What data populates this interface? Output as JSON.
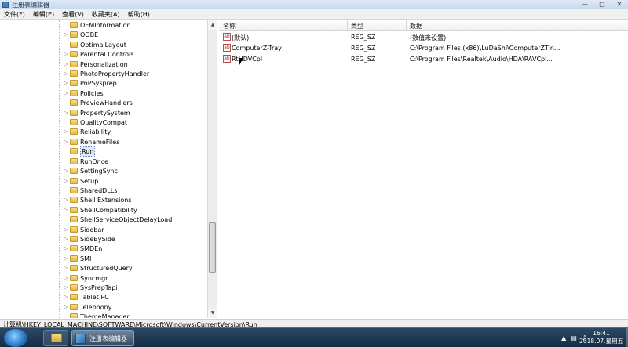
{
  "window": {
    "title": "注册表编辑器"
  },
  "menu": [
    "文件(F)",
    "编辑(E)",
    "查看(V)",
    "收藏夹(A)",
    "帮助(H)"
  ],
  "tree": {
    "items": [
      {
        "label": "OEMInformation",
        "expandable": false
      },
      {
        "label": "OOBE",
        "expandable": true
      },
      {
        "label": "OptimalLayout",
        "expandable": false
      },
      {
        "label": "Parental Controls",
        "expandable": true
      },
      {
        "label": "Personalization",
        "expandable": true
      },
      {
        "label": "PhotoPropertyHandler",
        "expandable": true
      },
      {
        "label": "PnPSysprep",
        "expandable": true
      },
      {
        "label": "Policies",
        "expandable": true
      },
      {
        "label": "PreviewHandlers",
        "expandable": false
      },
      {
        "label": "PropertySystem",
        "expandable": true
      },
      {
        "label": "QualityCompat",
        "expandable": false
      },
      {
        "label": "Reliability",
        "expandable": true
      },
      {
        "label": "RenameFiles",
        "expandable": true
      },
      {
        "label": "Run",
        "expandable": false,
        "selected": true
      },
      {
        "label": "RunOnce",
        "expandable": false
      },
      {
        "label": "SettingSync",
        "expandable": true
      },
      {
        "label": "Setup",
        "expandable": true
      },
      {
        "label": "SharedDLLs",
        "expandable": false
      },
      {
        "label": "Shell Extensions",
        "expandable": true
      },
      {
        "label": "ShellCompatibility",
        "expandable": true
      },
      {
        "label": "ShellServiceObjectDelayLoad",
        "expandable": false
      },
      {
        "label": "Sidebar",
        "expandable": true
      },
      {
        "label": "SideBySide",
        "expandable": true
      },
      {
        "label": "SMDEn",
        "expandable": true
      },
      {
        "label": "SMI",
        "expandable": true
      },
      {
        "label": "StructuredQuery",
        "expandable": true
      },
      {
        "label": "Syncmgr",
        "expandable": true
      },
      {
        "label": "SysPrepTapi",
        "expandable": true
      },
      {
        "label": "Tablet PC",
        "expandable": true
      },
      {
        "label": "Telephony",
        "expandable": true
      },
      {
        "label": "ThemeManager",
        "expandable": false
      }
    ]
  },
  "values": {
    "headers": [
      "名称",
      "类型",
      "数据"
    ],
    "rows": [
      {
        "name": "(默认)",
        "type": "REG_SZ",
        "data": "(数值未设置)"
      },
      {
        "name": "ComputerZ-Tray",
        "type": "REG_SZ",
        "data": "C:\\Program Files (x86)\\LuDaShi\\ComputerZTin..."
      },
      {
        "name": "RtHDVCpl",
        "type": "REG_SZ",
        "data": "C:\\Program Files\\Realtek\\Audio\\HDA\\RAVCpl..."
      }
    ]
  },
  "statusbar": {
    "path": "计算机\\HKEY_LOCAL_MACHINE\\SOFTWARE\\Microsoft\\Windows\\CurrentVersion\\Run"
  },
  "taskbar": {
    "active_app_label": "注册表编辑器",
    "time": "16:41",
    "date": "2018.07.星期五"
  },
  "icons": {
    "tree_node": "folder-icon",
    "value_type": "reg-string-icon",
    "start": "windows-start-icon"
  }
}
